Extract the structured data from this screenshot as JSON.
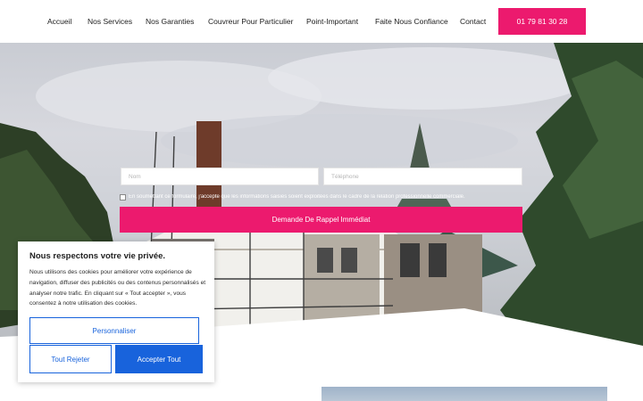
{
  "nav": {
    "items": [
      "Accueil",
      "Nos Services",
      "Nos Garanties",
      "Couvreur Pour Particulier",
      "Point-Important",
      "Faite Nous Confiance",
      "Contact"
    ],
    "phone": "01 79 81 30 28"
  },
  "form": {
    "name_placeholder": "Nom",
    "phone_placeholder": "Téléphone",
    "consent_text": "En soumettant ce formulaire, j'accepte que les informations saisies soient exploitées dans le cadre de la relation professionnelle commerciale.",
    "submit_label": "Demande De Rappel Immédiat"
  },
  "cookie": {
    "title": "Nous respectons votre vie privée.",
    "body": "Nous utilisons des cookies pour améliorer votre expérience de navigation, diffuser des publicités ou des contenus personnalisés et analyser notre trafic. En cliquant sur « Tout accepter », vous consentez à notre utilisation des cookies.",
    "customize_label": "Personnaliser",
    "reject_label": "Tout Rejeter",
    "accept_label": "Accepter Tout"
  },
  "colors": {
    "accent": "#ec1a6e",
    "cookie_blue": "#1863dc"
  }
}
